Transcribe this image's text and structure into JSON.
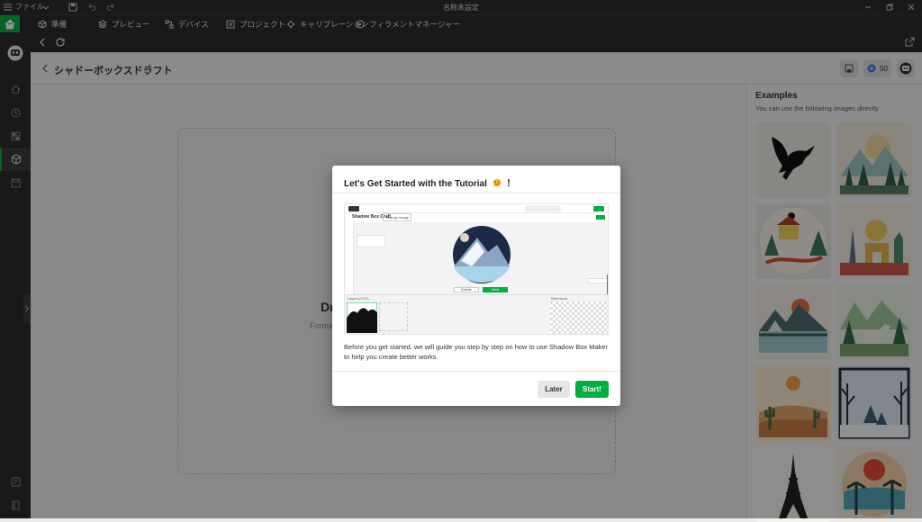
{
  "app": {
    "window_title": "名称未設定",
    "file_menu": "ファイル"
  },
  "tabs": [
    {
      "label": "準備",
      "icon": "cube-icon"
    },
    {
      "label": "プレビュー",
      "icon": "layers-icon"
    },
    {
      "label": "デバイス",
      "icon": "device-icon"
    },
    {
      "label": "プロジェクト",
      "icon": "project-icon"
    },
    {
      "label": "キャリブレーション",
      "icon": "calibration-icon"
    },
    {
      "label": "フィラメントマネージャー",
      "icon": "filament-icon"
    }
  ],
  "page": {
    "title": "シャドーボックスドラフト",
    "credits": "50",
    "drop_title_partial": "Dr",
    "drop_subtitle_partial": "Forma"
  },
  "examples": {
    "title": "Examples",
    "subtitle": "You can use the following images directly"
  },
  "modal": {
    "title": "Let's Get Started with the Tutorial",
    "title_suffix": "！",
    "description": "Before you get started, we will guide you step by step on how to use Shadow Box Maker to help you create better works.",
    "later_label": "Later",
    "start_label": "Start!",
    "preview": {
      "title": "Shadow Box Draft",
      "change_image": "Change image",
      "btn_left": "Delete",
      "btn_right": "Next",
      "layers_label": "Layers (1/10)",
      "reference_label": "Reference"
    }
  },
  "colors": {
    "accent": "#00ae42",
    "dark_chrome": "#2b2b2b"
  }
}
